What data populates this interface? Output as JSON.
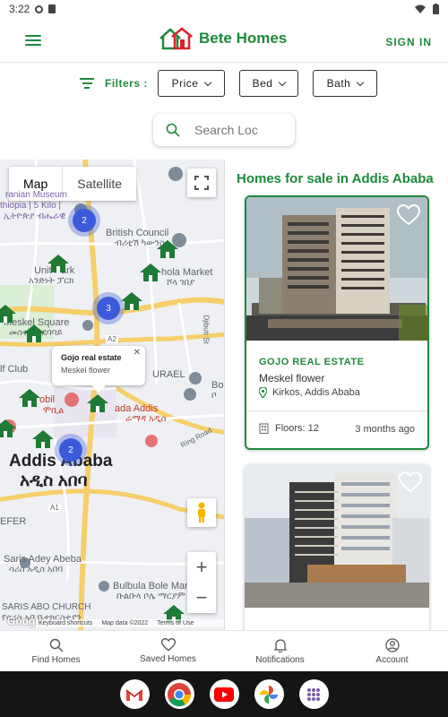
{
  "status_bar": {
    "time": "3:22"
  },
  "header": {
    "brand": "Bete Homes",
    "signin_label": "SIGN IN"
  },
  "filters": {
    "label": "Filters :",
    "buttons": [
      {
        "label": "Price"
      },
      {
        "label": "Bed"
      },
      {
        "label": "Bath"
      }
    ]
  },
  "search": {
    "placeholder": "Search Loc"
  },
  "map": {
    "type_map": "Map",
    "type_satellite": "Satellite",
    "labels": {
      "museum1": "ranian Museum",
      "museum2": "thiopia | 5 Kilo |",
      "museum3": "ኢትዮጵያ ብሔራዊ",
      "british1": "British Council",
      "british2": "ብሪቲሽ ካውንስል",
      "unity1": "Unit Park",
      "unity2": "አንድነት ፓርክ",
      "market1": "hola Market",
      "market2": "ሾላ ገበያ",
      "meskel1": "Meskel Square",
      "meskel2": "መስቀል አደባባይ",
      "djibuti": "Djibuti St",
      "golf": "lf Club",
      "urael": "URAEL",
      "bole1": "Bo",
      "bole2": "ቦ",
      "mobil": "obil",
      "mobil2": "ሞቢል",
      "ramada1": "ada Addis",
      "ramada2": "ራማዳ አዲስ",
      "ringroad": "Ring Road",
      "city": "Addis Ababa",
      "city_amh": "አዲስ አበባ",
      "lefer": "EFER",
      "saris1": "Saris Adey Abeba",
      "saris2": "ሳሪስ አዲስ አበባ",
      "bulbula1": "Bulbula Bole Maryam",
      "bulbula2": "ቡልቡላ ቦሌ ማርያም",
      "church1": "SARIS ABO CHURCH",
      "church2": "የሳሪስ አቦ ቤተክርስቲያን",
      "a2": "A2",
      "a1": "A1"
    },
    "clusters": [
      "2",
      "3",
      "2"
    ],
    "info_window": {
      "title": "Gojo real estate",
      "subtitle": "Meskel flower",
      "close": "✕"
    },
    "google": "Google",
    "attribution": {
      "shortcuts": "Keyboard shortcuts",
      "data": "Map data ©2022",
      "terms": "Terms of Use"
    },
    "zoom_in": "+",
    "zoom_out": "−"
  },
  "listings": {
    "title": "Homes for sale in Addis Ababa",
    "cards": [
      {
        "agency": "GOJO REAL ESTATE",
        "title": "Meskel flower",
        "location": "Kirkos, Addis Ababa",
        "floors": "Floors: 12",
        "posted": "3 months ago"
      }
    ]
  },
  "bottom_nav": {
    "items": [
      {
        "label": "Find Homes",
        "icon": "search-icon"
      },
      {
        "label": "Saved Homes",
        "icon": "heart-icon"
      },
      {
        "label": "Notifications",
        "icon": "bell-icon"
      },
      {
        "label": "Account",
        "icon": "account-icon"
      }
    ]
  },
  "dock": [
    "gmail",
    "chrome",
    "youtube",
    "photos",
    "app-drawer"
  ],
  "colors": {
    "brand_green": "#1e8a3b",
    "cluster_blue": "#3b5bdb"
  }
}
